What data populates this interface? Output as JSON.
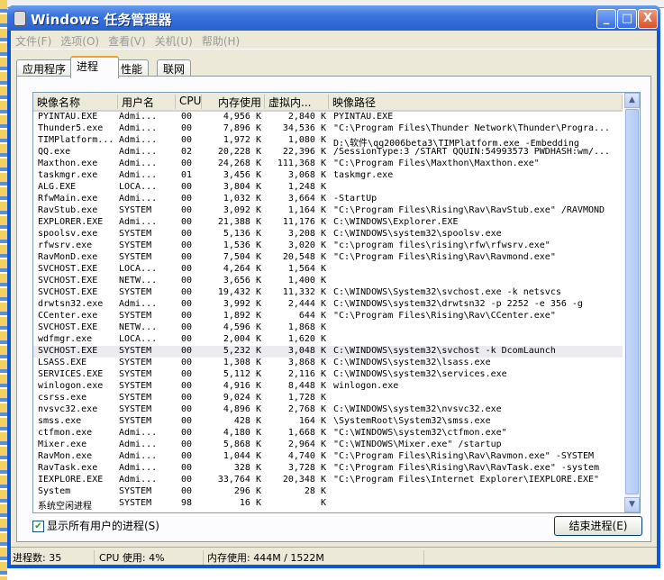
{
  "window": {
    "title": "Windows 任务管理器",
    "minimize": "_",
    "maximize": "□",
    "close": "X"
  },
  "menu": [
    "文件(F)",
    "选项(O)",
    "查看(V)",
    "关机(U)",
    "帮助(H)"
  ],
  "tabs": [
    "应用程序",
    "进程",
    "性能",
    "联网"
  ],
  "active_tab": 1,
  "columns": [
    "映像名称",
    "用户名",
    "CPU",
    "内存使用",
    "虚拟内...",
    "映像路径"
  ],
  "rows": [
    [
      "PYINTAU.EXE",
      "Admi...",
      "00",
      "4,956 K",
      "2,840 K",
      "PYINTAU.EXE"
    ],
    [
      "Thunder5.exe",
      "Admi...",
      "00",
      "7,896 K",
      "34,536 K",
      "\"C:\\Program Files\\Thunder Network\\Thunder\\Progra..."
    ],
    [
      "TIMPlatform...",
      "Admi...",
      "00",
      "1,972 K",
      "1,080 K",
      "D:\\软件\\qq2006beta3\\TIMPlatform.exe -Embedding"
    ],
    [
      "QQ.exe",
      "Admi...",
      "02",
      "20,228 K",
      "22,396 K",
      "/SessionType:3 /START QQUIN:54993573 PWDHASH:wm/..."
    ],
    [
      "Maxthon.exe",
      "Admi...",
      "00",
      "24,268 K",
      "111,368 K",
      "\"C:\\Program Files\\Maxthon\\Maxthon.exe\""
    ],
    [
      "taskmgr.exe",
      "Admi...",
      "01",
      "3,456 K",
      "3,068 K",
      "taskmgr.exe"
    ],
    [
      "ALG.EXE",
      "LOCA...",
      "00",
      "3,804 K",
      "1,248 K",
      ""
    ],
    [
      "RfwMain.exe",
      "Admi...",
      "00",
      "1,032 K",
      "3,664 K",
      " -StartUp"
    ],
    [
      "RavStub.exe",
      "SYSTEM",
      "00",
      "3,092 K",
      "1,164 K",
      "\"C:\\Program Files\\Rising\\Rav\\RavStub.exe\" /RAVMOND"
    ],
    [
      "EXPLORER.EXE",
      "Admi...",
      "00",
      "21,388 K",
      "11,176 K",
      "C:\\WINDOWS\\Explorer.EXE"
    ],
    [
      "spoolsv.exe",
      "SYSTEM",
      "00",
      "5,136 K",
      "3,208 K",
      "C:\\WINDOWS\\system32\\spoolsv.exe"
    ],
    [
      "rfwsrv.exe",
      "SYSTEM",
      "00",
      "1,536 K",
      "3,020 K",
      "\"c:\\program files\\rising\\rfw\\rfwsrv.exe\""
    ],
    [
      "RavMonD.exe",
      "SYSTEM",
      "00",
      "7,504 K",
      "20,548 K",
      "\"C:\\Program Files\\Rising\\Rav\\Ravmond.exe\""
    ],
    [
      "SVCHOST.EXE",
      "LOCA...",
      "00",
      "4,264 K",
      "1,564 K",
      ""
    ],
    [
      "SVCHOST.EXE",
      "NETW...",
      "00",
      "3,656 K",
      "1,400 K",
      ""
    ],
    [
      "SVCHOST.EXE",
      "SYSTEM",
      "00",
      "19,432 K",
      "11,332 K",
      "C:\\WINDOWS\\System32\\svchost.exe -k netsvcs"
    ],
    [
      "drwtsn32.exe",
      "Admi...",
      "00",
      "3,992 K",
      "2,444 K",
      "C:\\WINDOWS\\system32\\drwtsn32 -p 2252 -e 356 -g"
    ],
    [
      "CCenter.exe",
      "SYSTEM",
      "00",
      "1,892 K",
      "644 K",
      "\"C:\\Program Files\\Rising\\Rav\\CCenter.exe\""
    ],
    [
      "SVCHOST.EXE",
      "NETW...",
      "00",
      "4,596 K",
      "1,868 K",
      ""
    ],
    [
      "wdfmgr.exe",
      "LOCA...",
      "00",
      "2,004 K",
      "1,620 K",
      ""
    ],
    [
      "SVCHOST.EXE",
      "SYSTEM",
      "00",
      "5,232 K",
      "3,048 K",
      "C:\\WINDOWS\\system32\\svchost -k DcomLaunch"
    ],
    [
      "LSASS.EXE",
      "SYSTEM",
      "00",
      "1,308 K",
      "3,868 K",
      "C:\\WINDOWS\\system32\\lsass.exe"
    ],
    [
      "SERVICES.EXE",
      "SYSTEM",
      "00",
      "5,112 K",
      "2,116 K",
      "C:\\WINDOWS\\system32\\services.exe"
    ],
    [
      "winlogon.exe",
      "SYSTEM",
      "00",
      "4,916 K",
      "8,448 K",
      "winlogon.exe"
    ],
    [
      "csrss.exe",
      "SYSTEM",
      "00",
      "9,024 K",
      "1,728 K",
      ""
    ],
    [
      "nvsvc32.exe",
      "SYSTEM",
      "00",
      "4,896 K",
      "2,768 K",
      "C:\\WINDOWS\\system32\\nvsvc32.exe"
    ],
    [
      "smss.exe",
      "SYSTEM",
      "00",
      "428 K",
      "164 K",
      "\\SystemRoot\\System32\\smss.exe"
    ],
    [
      "ctfmon.exe",
      "Admi...",
      "00",
      "4,180 K",
      "1,668 K",
      "\"C:\\WINDOWS\\system32\\ctfmon.exe\""
    ],
    [
      "Mixer.exe",
      "Admi...",
      "00",
      "5,868 K",
      "2,964 K",
      "\"C:\\WINDOWS\\Mixer.exe\" /startup"
    ],
    [
      "RavMon.exe",
      "Admi...",
      "00",
      "1,044 K",
      "4,740 K",
      "\"C:\\Program Files\\Rising\\Rav\\Ravmon.exe\" -SYSTEM"
    ],
    [
      "RavTask.exe",
      "Admi...",
      "00",
      "328 K",
      "3,728 K",
      "\"C:\\Program Files\\Rising\\Rav\\RavTask.exe\" -system"
    ],
    [
      "IEXPLORE.EXE",
      "Admi...",
      "00",
      "33,764 K",
      "20,348 K",
      "\"C:\\Program Files\\Internet Explorer\\IEXPLORE.EXE\""
    ],
    [
      "System",
      "SYSTEM",
      "00",
      "296 K",
      "28 K",
      ""
    ],
    [
      "系统空闲进程",
      "SYSTEM",
      "98",
      "16 K",
      "K",
      ""
    ]
  ],
  "selected_row": 20,
  "show_all_users": {
    "label": "显示所有用户的进程(S)",
    "checked": true
  },
  "end_process_label": "结束进程(E)",
  "status": {
    "processes": "进程数: 35",
    "cpu": "CPU 使用: 4%",
    "memory": "内存使用: 444M / 1522M"
  }
}
